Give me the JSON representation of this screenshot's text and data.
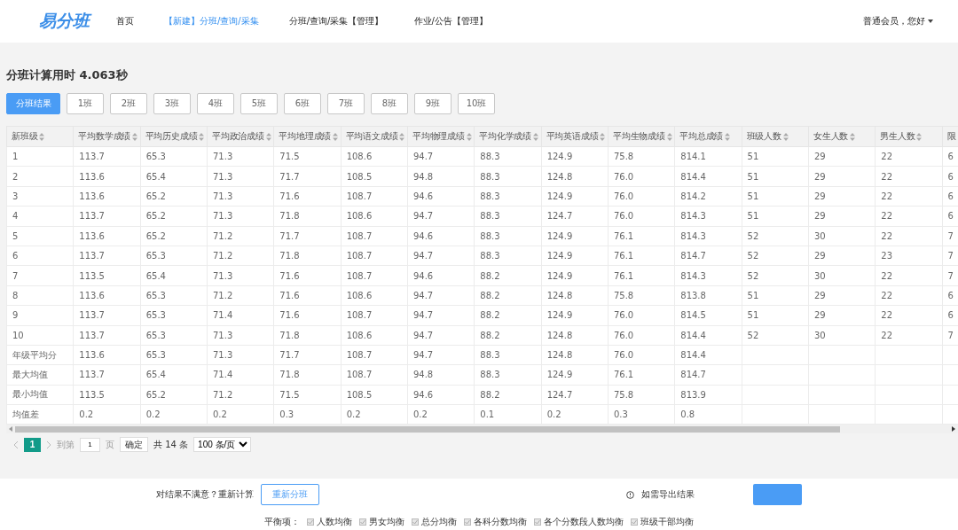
{
  "nav": {
    "logo": "易分班",
    "items": [
      {
        "label": "首页",
        "selected": false
      },
      {
        "label": "【新建】分班/查询/采集",
        "selected": true
      },
      {
        "label": "分班/查询/采集【管理】",
        "selected": false
      },
      {
        "label": "作业/公告【管理】",
        "selected": false
      }
    ],
    "user": "普通会员，您好"
  },
  "title": "分班计算用时 4.063秒",
  "tabs": [
    {
      "label": "分班结果",
      "selected": true
    },
    {
      "label": "1班",
      "selected": false
    },
    {
      "label": "2班",
      "selected": false
    },
    {
      "label": "3班",
      "selected": false
    },
    {
      "label": "4班",
      "selected": false
    },
    {
      "label": "5班",
      "selected": false
    },
    {
      "label": "6班",
      "selected": false
    },
    {
      "label": "7班",
      "selected": false
    },
    {
      "label": "8班",
      "selected": false
    },
    {
      "label": "9班",
      "selected": false
    },
    {
      "label": "10班",
      "selected": false
    }
  ],
  "table": {
    "columns": [
      "新班级",
      "平均数学成绩",
      "平均历史成绩",
      "平均政治成绩",
      "平均地理成绩",
      "平均语文成绩",
      "平均物理成绩",
      "平均化学成绩",
      "平均英语成绩",
      "平均生物成绩",
      "平均总成绩",
      "班级人数",
      "女生人数",
      "男生人数",
      "限"
    ],
    "rows": [
      [
        "1",
        "113.7",
        "65.3",
        "71.3",
        "71.5",
        "108.6",
        "94.7",
        "88.3",
        "124.9",
        "75.8",
        "814.1",
        "51",
        "29",
        "22",
        "6"
      ],
      [
        "2",
        "113.6",
        "65.4",
        "71.3",
        "71.7",
        "108.5",
        "94.8",
        "88.3",
        "124.8",
        "76.0",
        "814.4",
        "51",
        "29",
        "22",
        "6"
      ],
      [
        "3",
        "113.6",
        "65.2",
        "71.3",
        "71.6",
        "108.7",
        "94.6",
        "88.3",
        "124.9",
        "76.0",
        "814.2",
        "51",
        "29",
        "22",
        "6"
      ],
      [
        "4",
        "113.7",
        "65.2",
        "71.3",
        "71.8",
        "108.6",
        "94.7",
        "88.3",
        "124.7",
        "76.0",
        "814.3",
        "51",
        "29",
        "22",
        "6"
      ],
      [
        "5",
        "113.6",
        "65.2",
        "71.2",
        "71.7",
        "108.7",
        "94.6",
        "88.3",
        "124.9",
        "76.1",
        "814.3",
        "52",
        "30",
        "22",
        "7"
      ],
      [
        "6",
        "113.7",
        "65.3",
        "71.2",
        "71.8",
        "108.7",
        "94.7",
        "88.3",
        "124.9",
        "76.1",
        "814.7",
        "52",
        "29",
        "23",
        "7"
      ],
      [
        "7",
        "113.5",
        "65.4",
        "71.3",
        "71.6",
        "108.7",
        "94.6",
        "88.2",
        "124.9",
        "76.1",
        "814.3",
        "52",
        "30",
        "22",
        "7"
      ],
      [
        "8",
        "113.6",
        "65.3",
        "71.2",
        "71.6",
        "108.6",
        "94.7",
        "88.2",
        "124.8",
        "75.8",
        "813.8",
        "51",
        "29",
        "22",
        "6"
      ],
      [
        "9",
        "113.7",
        "65.3",
        "71.4",
        "71.6",
        "108.7",
        "94.7",
        "88.2",
        "124.9",
        "76.0",
        "814.5",
        "51",
        "29",
        "22",
        "6"
      ],
      [
        "10",
        "113.7",
        "65.3",
        "71.3",
        "71.8",
        "108.6",
        "94.7",
        "88.2",
        "124.8",
        "76.0",
        "814.4",
        "52",
        "30",
        "22",
        "7"
      ],
      [
        "年级平均分",
        "113.6",
        "65.3",
        "71.3",
        "71.7",
        "108.7",
        "94.7",
        "88.3",
        "124.8",
        "76.0",
        "814.4"
      ],
      [
        "最大均值",
        "113.7",
        "65.4",
        "71.4",
        "71.8",
        "108.7",
        "94.8",
        "88.3",
        "124.9",
        "76.1",
        "814.7"
      ],
      [
        "最小均值",
        "113.5",
        "65.2",
        "71.2",
        "71.5",
        "108.5",
        "94.6",
        "88.2",
        "124.7",
        "75.8",
        "813.9"
      ],
      [
        "均值差",
        "0.2",
        "0.2",
        "0.2",
        "0.3",
        "0.2",
        "0.2",
        "0.1",
        "0.2",
        "0.3",
        "0.8"
      ]
    ]
  },
  "pagination": {
    "pages": [
      {
        "label": "1",
        "selected": true
      }
    ],
    "goto_label": "到第",
    "goto_value": "1",
    "page_unit": "页",
    "confirm": "确定",
    "total": "共 14 条",
    "page_size": "100 条/页"
  },
  "footer": {
    "retry_text": "对结果不满意？重新计算",
    "retry_button": "重新分班",
    "export_tip": "如需导出结果",
    "balance_label": "平衡项：",
    "balance_items": [
      {
        "label": "人数均衡",
        "checked": true,
        "disabled": true
      },
      {
        "label": "男女均衡",
        "checked": true,
        "disabled": true
      },
      {
        "label": "总分均衡",
        "checked": true,
        "disabled": true
      },
      {
        "label": "各科分数均衡",
        "checked": true,
        "disabled": true
      },
      {
        "label": "各个分数段人数均衡",
        "checked": true,
        "disabled": true
      },
      {
        "label": "班级干部均衡",
        "checked": true,
        "disabled": true
      }
    ]
  }
}
